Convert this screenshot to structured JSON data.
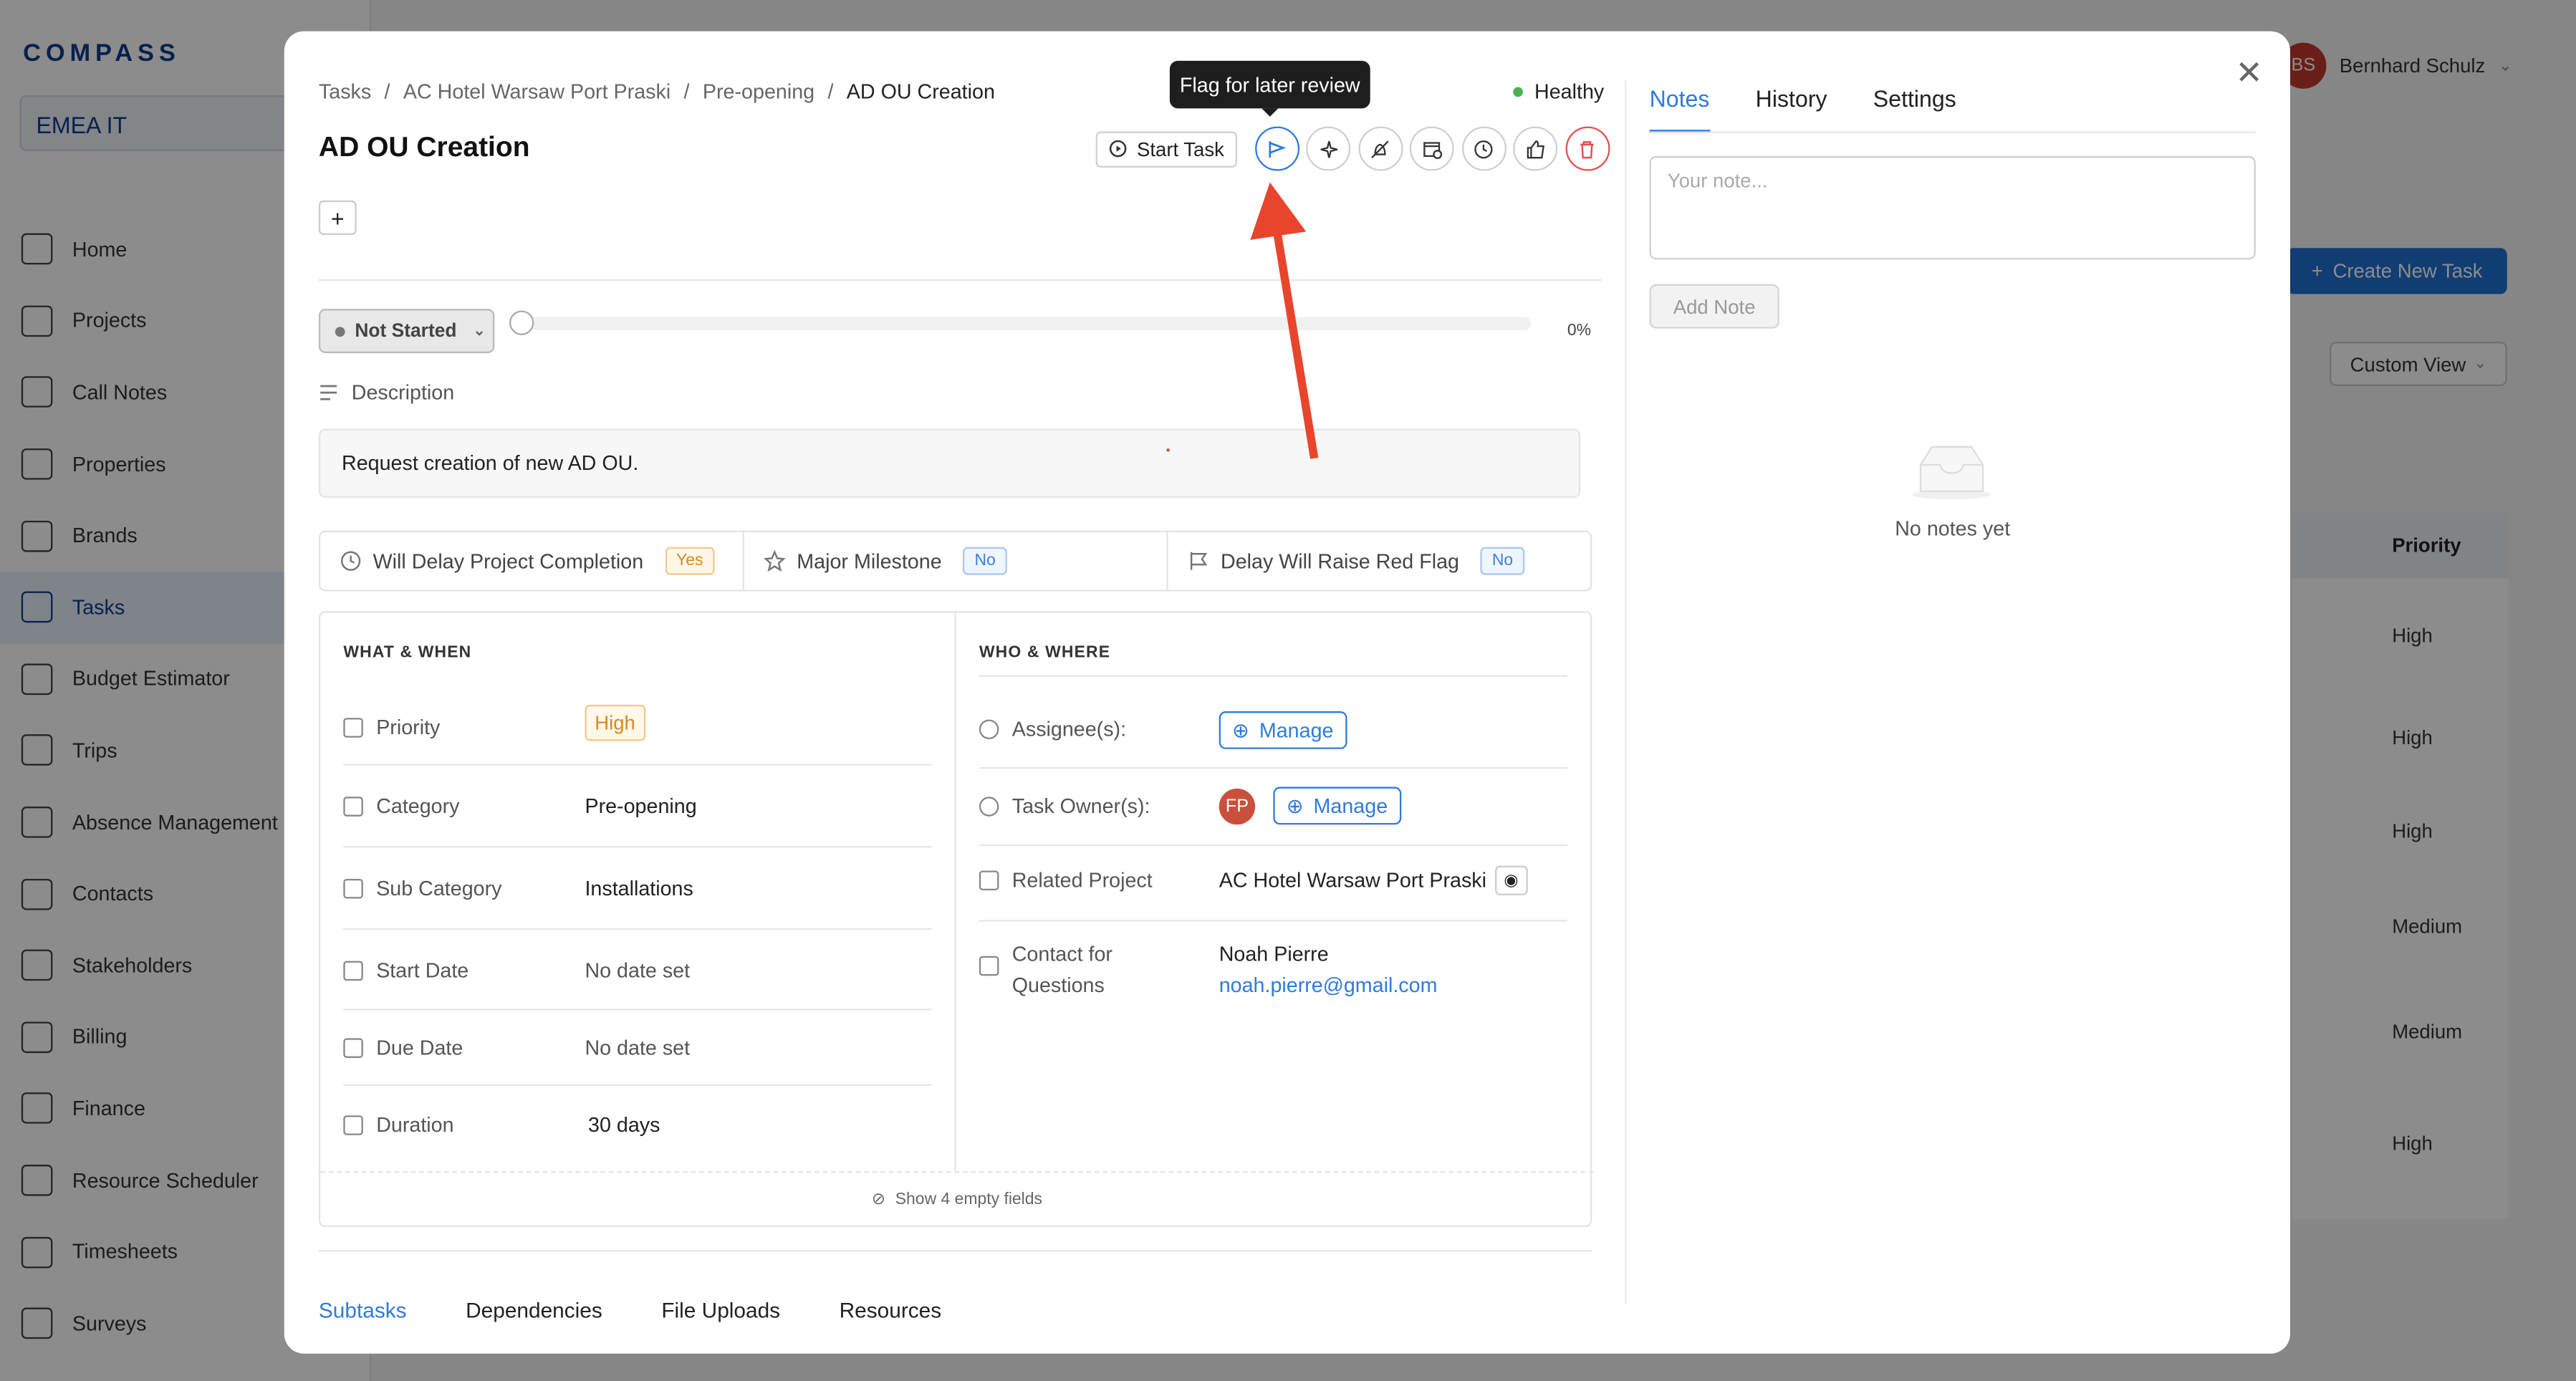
{
  "app": {
    "logo": "COMPASS",
    "workspace": "EMEA IT",
    "user_initials": "BS",
    "user_name": "Bernhard Schulz",
    "create_task": "Create New Task",
    "custom_view": "Custom View",
    "nav": [
      {
        "label": "Home",
        "icon": "home-icon"
      },
      {
        "label": "Projects",
        "icon": "briefcase-icon"
      },
      {
        "label": "Call Notes",
        "icon": "notebook-icon"
      },
      {
        "label": "Properties",
        "icon": "building-icon"
      },
      {
        "label": "Brands",
        "icon": "badge-icon"
      },
      {
        "label": "Tasks",
        "icon": "grid-icon",
        "active": true
      },
      {
        "label": "Budget Estimator",
        "icon": "dollar-icon"
      },
      {
        "label": "Trips",
        "icon": "plane-icon"
      },
      {
        "label": "Absence Management",
        "icon": "calendar-x-icon"
      },
      {
        "label": "Contacts",
        "icon": "contacts-icon"
      },
      {
        "label": "Stakeholders",
        "icon": "pen-icon"
      },
      {
        "label": "Billing",
        "icon": "billing-icon"
      },
      {
        "label": "Finance",
        "icon": "euro-icon"
      },
      {
        "label": "Resource Scheduler",
        "icon": "calendar-plus-icon"
      },
      {
        "label": "Timesheets",
        "icon": "timer-icon"
      },
      {
        "label": "Surveys",
        "icon": "list-check-icon"
      }
    ],
    "table": {
      "priority_header": "Priority",
      "priorities": [
        "High",
        "High",
        "High",
        "Medium",
        "Medium",
        "High"
      ]
    }
  },
  "modal": {
    "breadcrumb": [
      "Tasks",
      "AC Hotel Warsaw Port Praski",
      "Pre-opening",
      "AD OU Creation"
    ],
    "title": "AD OU Creation",
    "health": "Healthy",
    "start_task": "Start Task",
    "tooltip": "Flag for later review",
    "status": "Not Started",
    "progress_percent": 0,
    "progress_label": "0%",
    "description_label": "Description",
    "description": "Request creation of new AD OU.",
    "flags": [
      {
        "label": "Will Delay Project Completion",
        "value": "Yes",
        "icon": "clock-icon"
      },
      {
        "label": "Major Milestone",
        "value": "No",
        "icon": "star-icon"
      },
      {
        "label": "Delay Will Raise Red Flag",
        "value": "No",
        "icon": "flag-icon"
      }
    ],
    "what_when": {
      "heading": "WHAT & WHEN",
      "priority_label": "Priority",
      "priority": "High",
      "category_label": "Category",
      "category": "Pre-opening",
      "subcategory_label": "Sub Category",
      "subcategory": "Installations",
      "start_label": "Start Date",
      "start": "No date set",
      "due_label": "Due Date",
      "due": "No date set",
      "duration_label": "Duration",
      "duration": "30 days"
    },
    "who_where": {
      "heading": "WHO & WHERE",
      "assignee_label": "Assignee(s):",
      "owner_label": "Task Owner(s):",
      "owner_initials": "FP",
      "manage": "Manage",
      "project_label": "Related Project",
      "project": "AC Hotel Warsaw Port Praski",
      "contact_label_1": "Contact for",
      "contact_label_2": "Questions",
      "contact_name": "Noah Pierre",
      "contact_email": "noah.pierre@gmail.com"
    },
    "show_empty": "Show 4 empty fields",
    "subtabs": [
      "Subtasks",
      "Dependencies",
      "File Uploads",
      "Resources"
    ],
    "right_tabs": [
      "Notes",
      "History",
      "Settings"
    ],
    "note_placeholder": "Your note...",
    "add_note": "Add Note",
    "no_notes": "No notes yet",
    "colors": {
      "accent": "#2f7bd9",
      "danger": "#e05050",
      "annotation_arrow": "#e8452c"
    }
  }
}
